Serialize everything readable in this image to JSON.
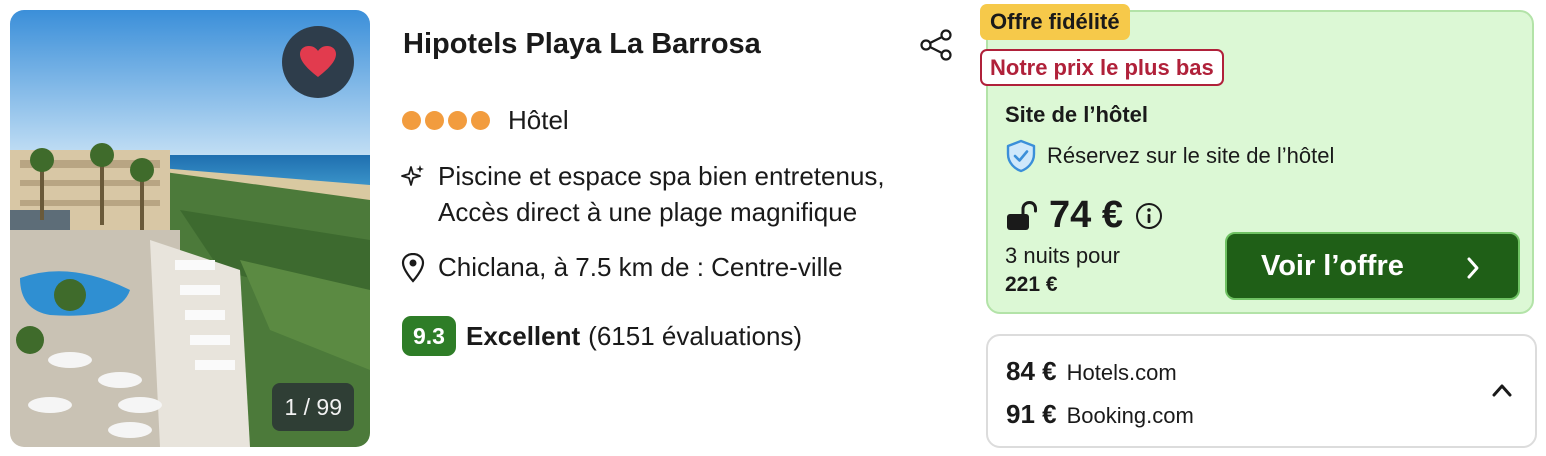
{
  "hotel": {
    "name": "Hipotels Playa La Barrosa",
    "star_rating": 4,
    "type": "Hôtel",
    "highlights": "Piscine et espace spa bien entretenus, Accès direct à une plage magnifique",
    "location": "Chiclana, à 7.5 km de : Centre-ville"
  },
  "photo": {
    "counter": "1 / 99",
    "favorite_icon": "heart-icon"
  },
  "rating": {
    "score": "9.3",
    "label": "Excellent",
    "reviews": "(6151 évaluations)"
  },
  "offer": {
    "badge_loyalty": "Offre fidélité",
    "badge_lowest": "Notre prix le plus bas",
    "provider": "Site de l’hôtel",
    "book_direct": "Réservez sur le site de l’hôtel",
    "price": "74 €",
    "nights_label": "3 nuits pour",
    "total": "221 €",
    "cta_label": "Voir l’offre"
  },
  "other_offers": [
    {
      "price": "84 €",
      "site": "Hotels.com"
    },
    {
      "price": "91 €",
      "site": "Booking.com"
    }
  ],
  "colors": {
    "score_badge": "#2e7d27",
    "stars": "#f29c3e",
    "offer_bg": "#dcf8d5",
    "cta_bg": "#1f5f17",
    "loyalty_badge": "#f6c94a",
    "lowest_badge": "#b0213a",
    "favorite_heart": "#e23b4e"
  }
}
